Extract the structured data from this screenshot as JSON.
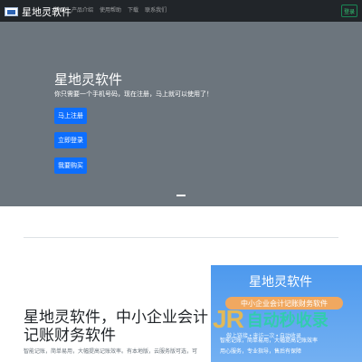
{
  "navbar": {
    "brand": "星地灵软件",
    "links": [
      "首页",
      "产品介绍",
      "使用帮助",
      "下载",
      "联系我们"
    ],
    "login_label": "登录"
  },
  "hero": {
    "title": "星地灵软件",
    "subtitle": "你只需要一个手机号码，现在注册，马上就可以使用了！",
    "buttons": [
      "马上注册",
      "立即登录",
      "我要购买"
    ]
  },
  "feature": {
    "title": "星地灵软件，中小企业会计记账财务软件",
    "description": "智能记账，简单易用，大幅提高记账效率。有本地版，云服务版可选，可"
  },
  "promo": {
    "title": "星地灵软件",
    "pill": "中小企业会计记账财务软件",
    "line1": "智能记账，简单易用，大幅提高记账效率",
    "line2": "用心服务，专业指导，售后有保障"
  },
  "watermark": {
    "logo": "JR",
    "text": "自动秒收录",
    "sub": "做上链接 • 来访一次 • 自动收录"
  },
  "colors": {
    "navbar": "#212529",
    "hero": "#6c757d",
    "primary": "#0d6efd",
    "success": "#198754",
    "promo": "#4d99ee"
  }
}
